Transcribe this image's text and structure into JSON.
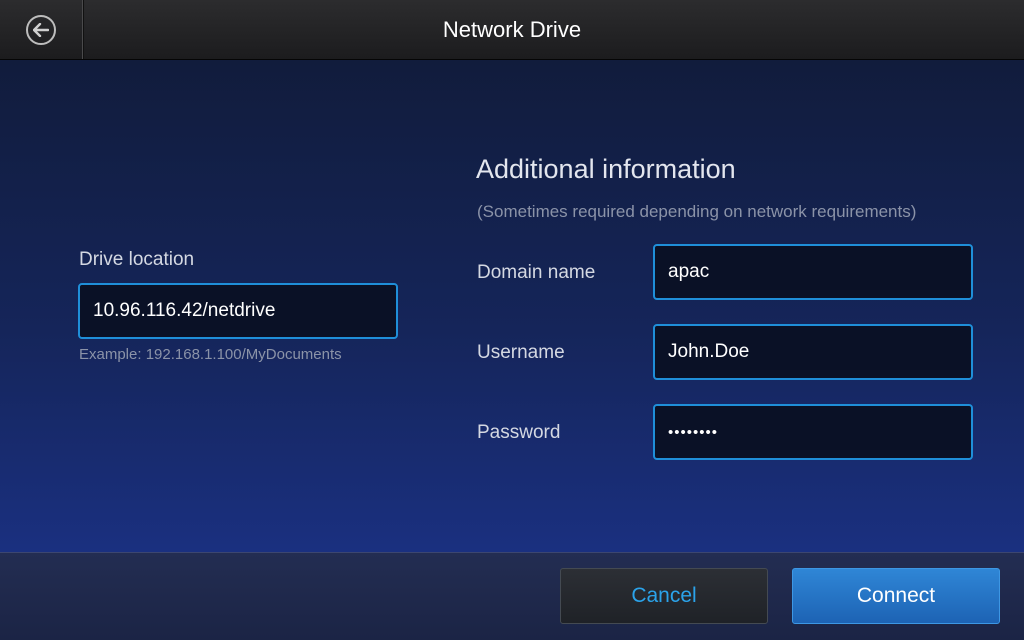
{
  "header": {
    "title": "Network Drive",
    "back_icon": "back-arrow-icon"
  },
  "drive": {
    "label": "Drive location",
    "value": "10.96.116.42/netdrive",
    "hint": "Example: 192.168.1.100/MyDocuments"
  },
  "additional": {
    "title": "Additional information",
    "subtitle": "(Sometimes required depending on network requirements)",
    "domain_label": "Domain name",
    "domain_value": "apac",
    "username_label": "Username",
    "username_value": "John.Doe",
    "password_label": "Password",
    "password_value": "••••••••"
  },
  "footer": {
    "cancel_label": "Cancel",
    "connect_label": "Connect"
  },
  "colors": {
    "accent": "#1f8fd9",
    "connect_button": "#2a7ccb",
    "cancel_text": "#2ba3ea"
  }
}
